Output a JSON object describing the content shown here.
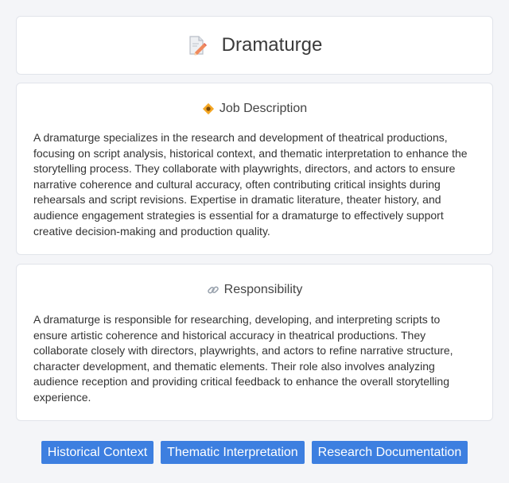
{
  "header": {
    "title": "Dramaturge",
    "icon": "document-pencil-icon"
  },
  "job_description": {
    "heading": "Job Description",
    "icon": "diamond-badge-icon",
    "text": "A dramaturge specializes in the research and development of theatrical productions, focusing on script analysis, historical context, and thematic interpretation to enhance the storytelling process. They collaborate with playwrights, directors, and actors to ensure narrative coherence and cultural accuracy, often contributing critical insights during rehearsals and script revisions. Expertise in dramatic literature, theater history, and audience engagement strategies is essential for a dramaturge to effectively support creative decision-making and production quality."
  },
  "responsibility": {
    "heading": "Responsibility",
    "icon": "link-icon",
    "text": "A dramaturge is responsible for researching, developing, and interpreting scripts to ensure artistic coherence and historical accuracy in theatrical productions. They collaborate closely with directors, playwrights, and actors to refine narrative structure, character development, and thematic elements. Their role also involves analyzing audience reception and providing critical feedback to enhance the overall storytelling experience."
  },
  "tags": [
    "Historical Context",
    "Thematic Interpretation",
    "Research Documentation"
  ],
  "colors": {
    "tag_background": "#3d7fe0",
    "page_background": "#f4f5f8"
  }
}
